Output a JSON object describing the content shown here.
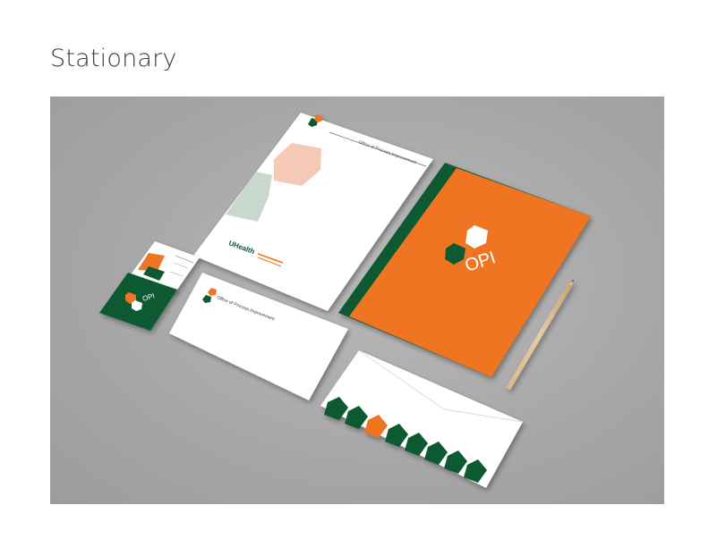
{
  "page": {
    "title": "Stationary"
  },
  "brand": {
    "name": "OPI",
    "department": "Office of Process Improvement",
    "envelope_return": "Office of Process Improvement",
    "uhealth_logo": "UHealth",
    "colors": {
      "orange": "#f07422",
      "green": "#0e5a30",
      "peach": "#f4c9b6",
      "sage": "#c9d8cf"
    }
  }
}
